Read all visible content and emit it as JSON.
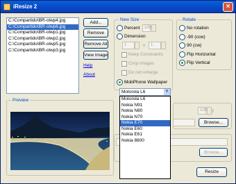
{
  "window": {
    "title": "iResize 2",
    "close": "×"
  },
  "files": [
    {
      "name": "C:\\Compartido\\BR-olwp4.jpg",
      "selected": false
    },
    {
      "name": "C:\\Compartido\\BR-olwp6.jpg",
      "selected": true
    },
    {
      "name": "C:\\Compartido\\BR-olwp1.jpg",
      "selected": false
    },
    {
      "name": "C:\\Compartido\\BR-olwp2.jpg",
      "selected": false
    },
    {
      "name": "C:\\Compartido\\BR-olwp5.jpg",
      "selected": false
    },
    {
      "name": "C:\\Compartido\\BR-olwp3.jpg",
      "selected": false
    }
  ],
  "buttons": {
    "add": "Add...",
    "remove": "Remove",
    "remove_all": "Remove All",
    "view_image": "View Image",
    "browse": "Browse...",
    "browse2": "Browse...",
    "resize": "Resize"
  },
  "links": {
    "help": "Help",
    "about": "About"
  },
  "new_size": {
    "label": "New Size",
    "percent": "Percent",
    "percent_value": "100",
    "dimension": "Dimension",
    "width": "1",
    "times": "x",
    "height": "1",
    "keep_constraints": "Keep Constraints",
    "crop_images": "Crop Images",
    "do_not_enlarge": "Do not enlarge",
    "mobphone": "MobPhone Wallpaper",
    "mobphone_selected": "Motorola L6"
  },
  "rotate": {
    "label": "Rotate",
    "options": [
      "No rotation",
      "-90 (ccw)",
      "90 (cw)",
      "Flip Horizontal",
      "Flip Vertical"
    ],
    "selected": "Flip Vertical"
  },
  "phone_models": [
    {
      "name": "Motorola L6",
      "selected": false
    },
    {
      "name": "Nokia N91",
      "selected": false
    },
    {
      "name": "Nokia N80",
      "selected": false
    },
    {
      "name": "Nokia N70",
      "selected": false
    },
    {
      "name": "Nokia E70",
      "selected": true
    },
    {
      "name": "Nokia E60",
      "selected": false
    },
    {
      "name": "Nokia E61",
      "selected": false
    },
    {
      "name": "Nokia 8800",
      "selected": false
    }
  ],
  "preview": {
    "label": "Preview"
  },
  "output": {
    "quality_label": "Quality",
    "quality_value": "100"
  }
}
